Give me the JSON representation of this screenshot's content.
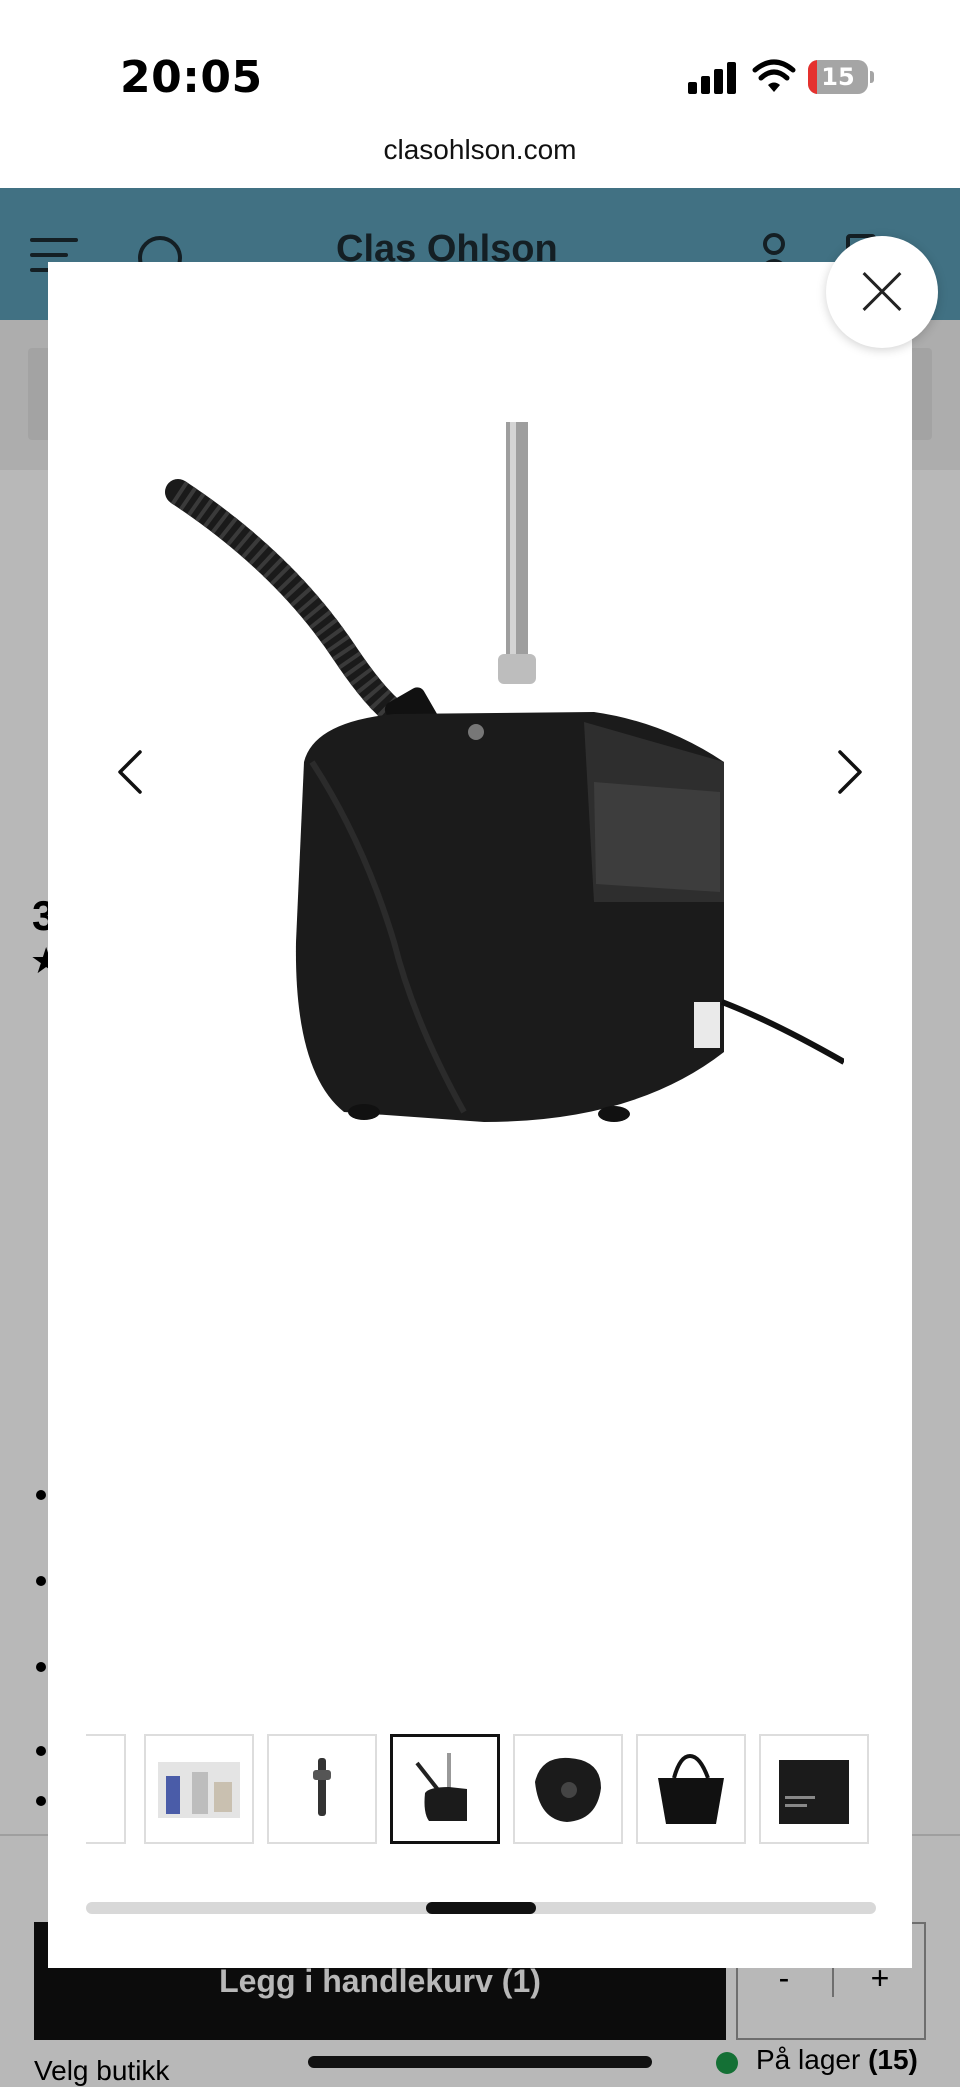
{
  "status_bar": {
    "time": "20:05",
    "battery_level": "15",
    "battery_fraction": 0.15,
    "icons": [
      "signal-icon",
      "wifi-icon",
      "battery-icon"
    ],
    "battery_low_color": "#e5312e"
  },
  "browser": {
    "url": "clasohlson.com"
  },
  "site_header": {
    "brand": "Clas Ohlson",
    "background_color": "#5b9db6",
    "icons": [
      "menu-icon",
      "search-icon",
      "account-icon",
      "cart-icon"
    ]
  },
  "page": {
    "fragment_heading": "3",
    "fragment_rating": "★",
    "add_to_cart_label": "Legg i handlekurv",
    "add_to_cart_count": "(1)",
    "qty_minus": "-",
    "qty_plus": "+",
    "store_select": "Velg butikk",
    "stock_label": "På lager",
    "stock_count": "(15)",
    "stock_color": "#1d9b4a"
  },
  "gallery": {
    "icons": [
      "close-icon",
      "chevron-left-icon",
      "chevron-right-icon"
    ],
    "main_image": "garment-steamer-black",
    "thumbnails": [
      {
        "name": "thumb-partial",
        "active": false
      },
      {
        "name": "thumb-room-scene",
        "active": false
      },
      {
        "name": "thumb-steamer-head",
        "active": false
      },
      {
        "name": "thumb-steamer-base",
        "active": true
      },
      {
        "name": "thumb-steamer-hose",
        "active": false
      },
      {
        "name": "thumb-tote-bag",
        "active": false
      },
      {
        "name": "thumb-box",
        "active": false
      }
    ],
    "scroll_position_fraction": 0.43,
    "scroll_visible_fraction": 0.14
  }
}
